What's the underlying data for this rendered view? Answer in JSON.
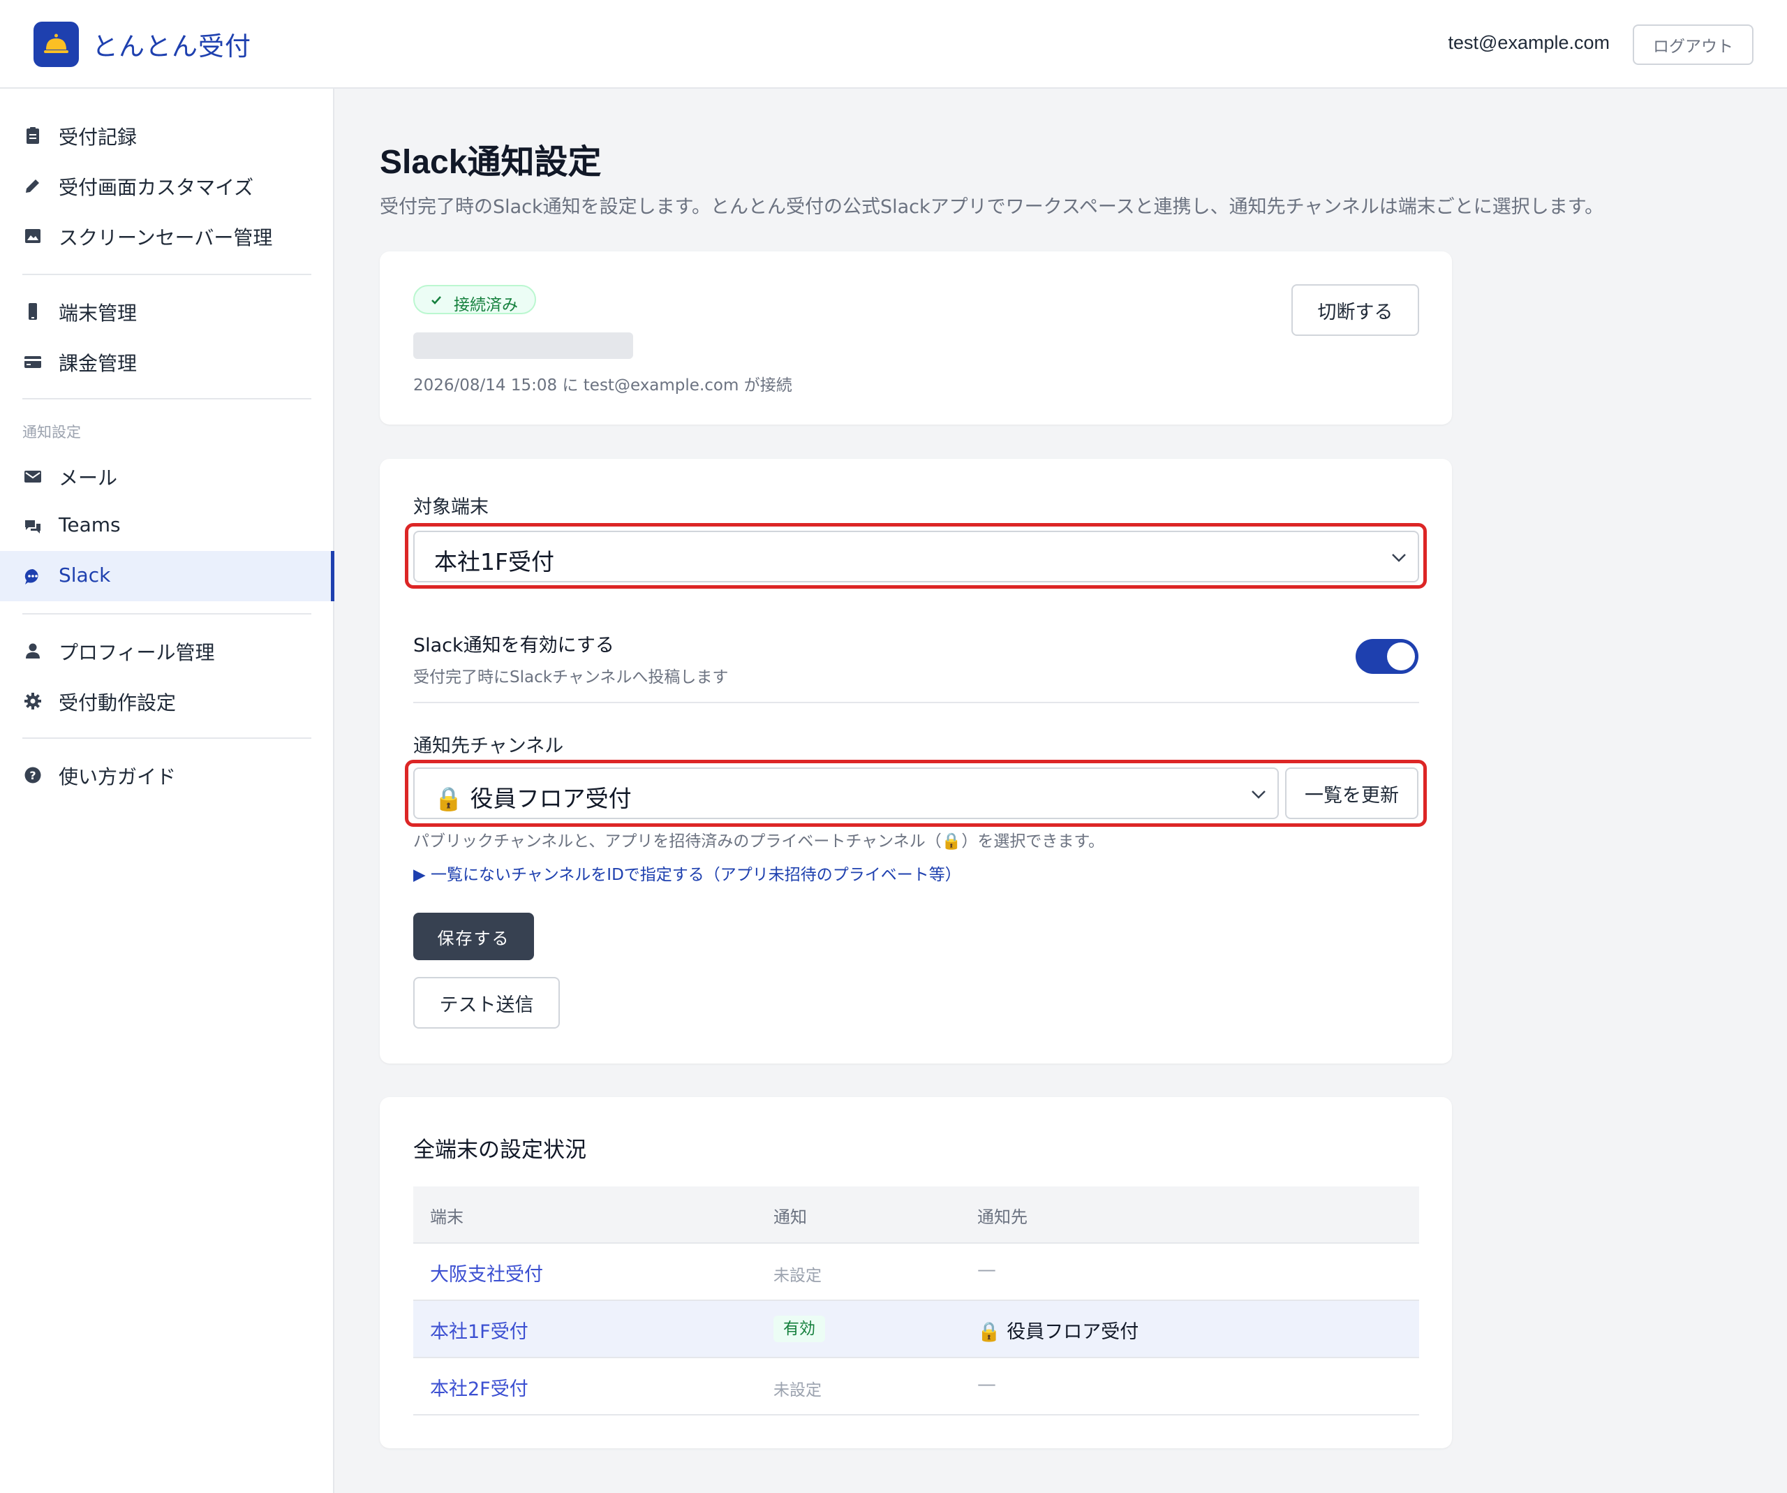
{
  "header": {
    "app_title": "とんとん受付",
    "user_email": "test@example.com",
    "logout_label": "ログアウト"
  },
  "sidebar": {
    "items": [
      {
        "label": "受付記録",
        "icon": "clipboard-icon"
      },
      {
        "label": "受付画面カスタマイズ",
        "icon": "pencil-icon"
      },
      {
        "label": "スクリーンセーバー管理",
        "icon": "image-icon"
      },
      {
        "label": "端末管理",
        "icon": "phone-icon"
      },
      {
        "label": "課金管理",
        "icon": "credit-card-icon"
      },
      {
        "label": "メール",
        "icon": "mail-icon"
      },
      {
        "label": "Teams",
        "icon": "chat-bubbles-icon"
      },
      {
        "label": "Slack",
        "icon": "chat-dots-icon",
        "active": true
      },
      {
        "label": "プロフィール管理",
        "icon": "person-icon"
      },
      {
        "label": "受付動作設定",
        "icon": "gear-icon"
      },
      {
        "label": "使い方ガイド",
        "icon": "help-circle-icon"
      }
    ],
    "section_notify": "通知設定"
  },
  "main": {
    "title": "Slack通知設定",
    "subtitle": "受付完了時のSlack通知を設定します。とんとん受付の公式Slackアプリでワークスペースと連携し、通知先チャンネルは端末ごとに選択します。"
  },
  "connection": {
    "status_badge": "接続済み",
    "connected_info": "2026/08/14 15:08 に test@example.com が接続",
    "disconnect_label": "切断する"
  },
  "settings": {
    "device_label": "対象端末",
    "device_value": "本社1F受付",
    "enable_title": "Slack通知を有効にする",
    "enable_sub": "受付完了時にSlackチャンネルへ投稿します",
    "enabled": true,
    "channel_label": "通知先チャンネル",
    "channel_value": "🔒 役員フロア受付",
    "refresh_label": "一覧を更新",
    "help_text": "パブリックチャンネルと、アプリを招待済みのプライベートチャンネル（🔒）を選択できます。",
    "details_link": "▶ 一覧にないチャンネルをIDで指定する（アプリ未招待のプライベート等）",
    "save_label": "保存する",
    "test_label": "テスト送信"
  },
  "status_table": {
    "title": "全端末の設定状況",
    "headers": [
      "端末",
      "通知",
      "通知先"
    ],
    "rows": [
      {
        "device": "大阪支社受付",
        "notify": "未設定",
        "channel": "—"
      },
      {
        "device": "本社1F受付",
        "notify": "有効",
        "channel": "🔒 役員フロア受付"
      },
      {
        "device": "本社2F受付",
        "notify": "未設定",
        "channel": "—"
      }
    ]
  },
  "colors": {
    "brand": "#1e40af",
    "highlight_outline": "#dc2626",
    "success": "#15803d"
  }
}
